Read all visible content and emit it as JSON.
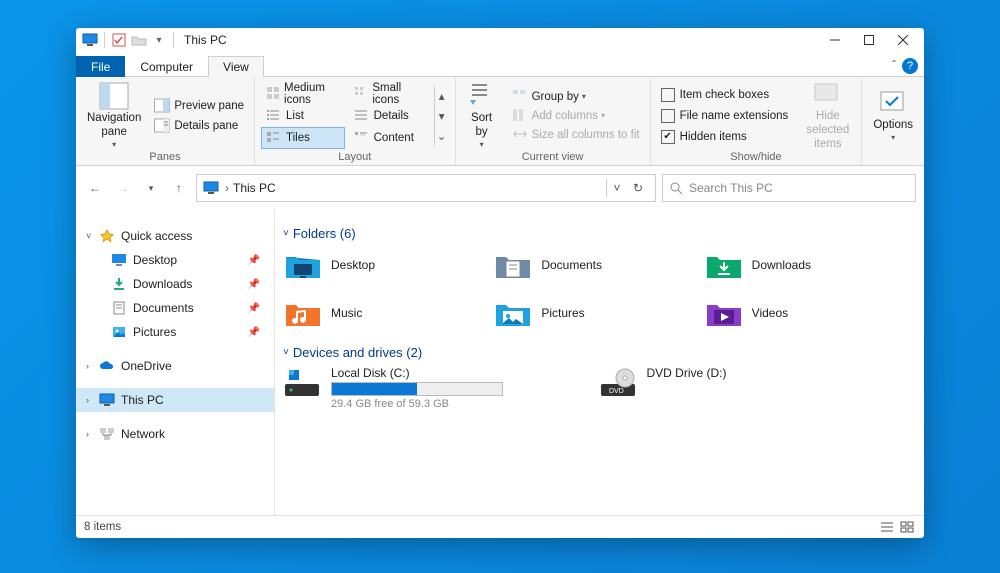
{
  "window": {
    "title": "This PC"
  },
  "tabs": {
    "file": "File",
    "computer": "Computer",
    "view": "View"
  },
  "ribbon": {
    "panes": {
      "nav": "Navigation\npane",
      "preview": "Preview pane",
      "details": "Details pane",
      "group": "Panes"
    },
    "layout": {
      "medium": "Medium icons",
      "small": "Small icons",
      "list": "List",
      "details": "Details",
      "tiles": "Tiles",
      "content": "Content",
      "group": "Layout"
    },
    "currentview": {
      "sort": "Sort\nby",
      "groupby": "Group by",
      "addcols": "Add columns",
      "sizeall": "Size all columns to fit",
      "group": "Current view"
    },
    "showhide": {
      "checkboxes": "Item check boxes",
      "ext": "File name extensions",
      "hidden": "Hidden items",
      "hideselected": "Hide selected\nitems",
      "group": "Show/hide"
    },
    "options": "Options"
  },
  "address": {
    "text": "This PC"
  },
  "search": {
    "placeholder": "Search This PC"
  },
  "nav": {
    "quick": "Quick access",
    "desktop": "Desktop",
    "downloads": "Downloads",
    "documents": "Documents",
    "pictures": "Pictures",
    "onedrive": "OneDrive",
    "thispc": "This PC",
    "network": "Network"
  },
  "content": {
    "folders_hdr": "Folders (6)",
    "folders": {
      "desktop": "Desktop",
      "documents": "Documents",
      "downloads": "Downloads",
      "music": "Music",
      "pictures": "Pictures",
      "videos": "Videos"
    },
    "drives_hdr": "Devices and drives (2)",
    "drives": {
      "c": {
        "name": "Local Disk (C:)",
        "sub": "29.4 GB free of 59.3 GB",
        "fillPercent": "50%"
      },
      "d": {
        "name": "DVD Drive (D:)"
      }
    }
  },
  "status": {
    "items": "8 items"
  }
}
